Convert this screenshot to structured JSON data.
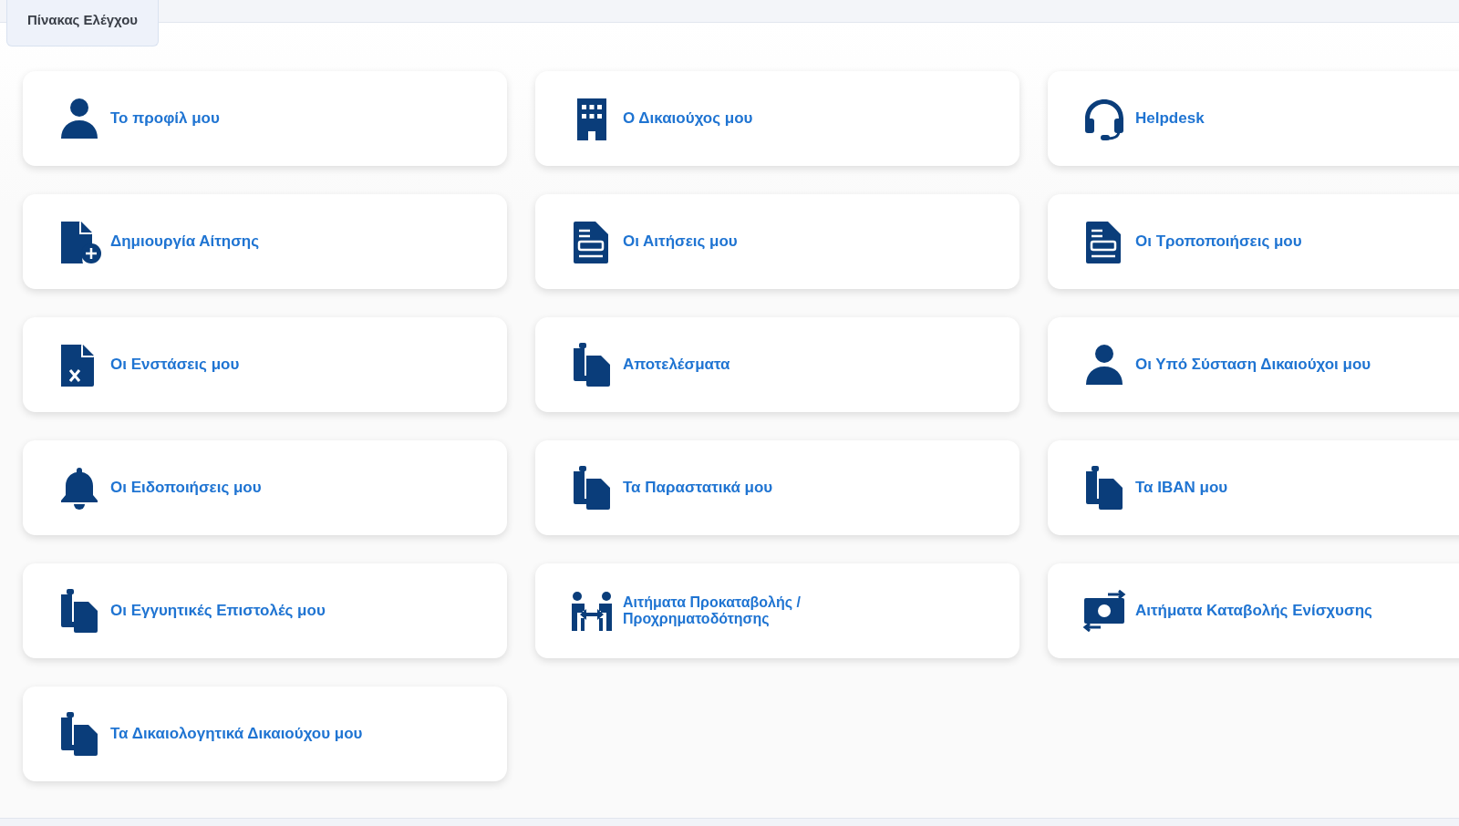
{
  "tab": {
    "label": "Πίνακας Ελέγχου",
    "selected": true
  },
  "tiles": [
    {
      "label": "Το προφίλ μου",
      "kind": "person"
    },
    {
      "label": "Ο Δικαιούχος μου",
      "kind": "building"
    },
    {
      "label": "Helpdesk",
      "kind": "headset"
    },
    {
      "label": "Δημιουργία Αίτησης",
      "kind": "file-plus"
    },
    {
      "label": "Οι Αιτήσεις μου",
      "kind": "file-form"
    },
    {
      "label": "Οι Τροποποιήσεις μου",
      "kind": "file-form"
    },
    {
      "label": "Οι Ενστάσεις μου",
      "kind": "file-x"
    },
    {
      "label": "Αποτελέσματα",
      "kind": "files"
    },
    {
      "label": "Οι Υπό Σύσταση Δικαιούχοι μου",
      "kind": "person"
    },
    {
      "label": "Οι Ειδοποιήσεις μου",
      "kind": "bell"
    },
    {
      "label": "Τα Παραστατικά μου",
      "kind": "files"
    },
    {
      "label": "Τα IBAN μου",
      "kind": "files"
    },
    {
      "label": "Οι Εγγυητικές Επιστολές μου",
      "kind": "files"
    },
    {
      "label": "Αιτήματα Προκαταβολής / Προχρηματοδότησης",
      "kind": "people-arrows",
      "compact": true
    },
    {
      "label": "Αιτήματα Καταβολής Ενίσχυσης",
      "kind": "money-exchange"
    },
    {
      "label": "Τα Δικαιολογητικά Δικαιούχου μου",
      "kind": "files"
    }
  ]
}
